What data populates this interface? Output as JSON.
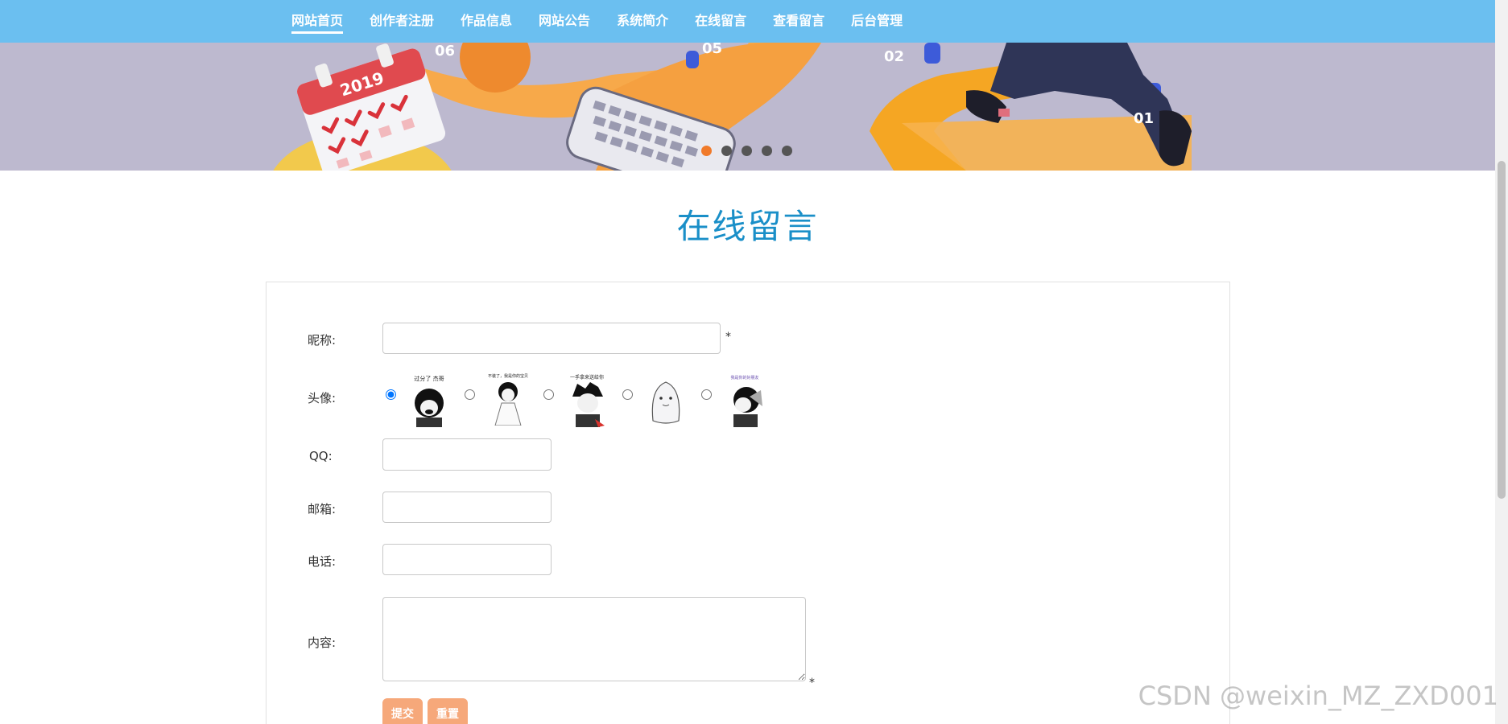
{
  "nav": {
    "items": [
      {
        "label": "网站首页",
        "name": "nav-home"
      },
      {
        "label": "创作者注册",
        "name": "nav-register"
      },
      {
        "label": "作品信息",
        "name": "nav-works"
      },
      {
        "label": "网站公告",
        "name": "nav-notice"
      },
      {
        "label": "系统简介",
        "name": "nav-about"
      },
      {
        "label": "在线留言",
        "name": "nav-message"
      },
      {
        "label": "查看留言",
        "name": "nav-view-messages"
      },
      {
        "label": "后台管理",
        "name": "nav-admin"
      }
    ],
    "active_index": 0
  },
  "banner": {
    "numbers": [
      "06",
      "05",
      "02",
      "01"
    ],
    "calendar_year": "2019",
    "slides": 5,
    "active_slide": 0,
    "colors": {
      "bg": "#bdb9cf",
      "accent": "#f5a623",
      "dot_active": "#f07a2a"
    }
  },
  "page_title": "在线留言",
  "form": {
    "nickname_label": "昵称:",
    "avatar_label": "头像:",
    "qq_label": "QQ:",
    "email_label": "邮箱:",
    "phone_label": "电话:",
    "content_label": "内容:",
    "required_mark": "*",
    "avatars": [
      {
        "caption": "过分了 杰哥",
        "checked": true
      },
      {
        "caption": "不装了，我是你的宝贝",
        "checked": false
      },
      {
        "caption": "一手拿来送给你",
        "checked": false
      },
      {
        "caption": "",
        "checked": false
      },
      {
        "caption": "我是你的好朋友",
        "checked": false
      }
    ],
    "submit_label": "提交",
    "reset_label": "重置"
  },
  "watermark": "CSDN @weixin_MZ_ZXD001",
  "theme": {
    "nav_bg": "#6bbff0",
    "title_color": "#1a8fc8",
    "button_bg": "#f6a87a"
  }
}
